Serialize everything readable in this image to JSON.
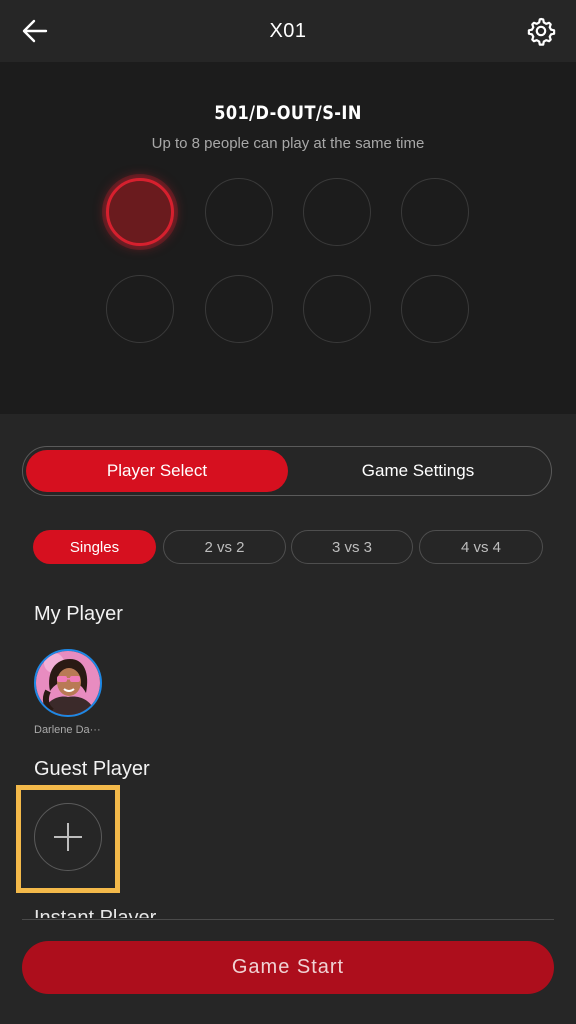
{
  "header": {
    "title": "X01",
    "back_icon": "arrow-left-icon",
    "settings_icon": "gear-icon"
  },
  "board": {
    "mode": "501/D-OUT/S-IN",
    "subtitle": "Up to 8 people can play at the same time",
    "slots_total": 8,
    "active_slot": 1
  },
  "segment": {
    "selected": "Player Select",
    "options": [
      "Player Select",
      "Game Settings"
    ]
  },
  "teams": {
    "selected": "Singles",
    "options": [
      "Singles",
      "2 vs 2",
      "3 vs 3",
      "4 vs 4"
    ]
  },
  "my_player": {
    "title": "My Player",
    "players": [
      {
        "name": "Darlene Da···"
      }
    ]
  },
  "guest_player": {
    "title": "Guest Player",
    "add_icon": "plus-icon"
  },
  "next_section_partial": "Instant Player",
  "footer": {
    "start_label": "Game Start"
  },
  "colors": {
    "accent_red": "#d6101f",
    "start_red": "#ad0e1c",
    "highlight": "#f3b94a",
    "avatar_ring": "#1e88e5"
  }
}
